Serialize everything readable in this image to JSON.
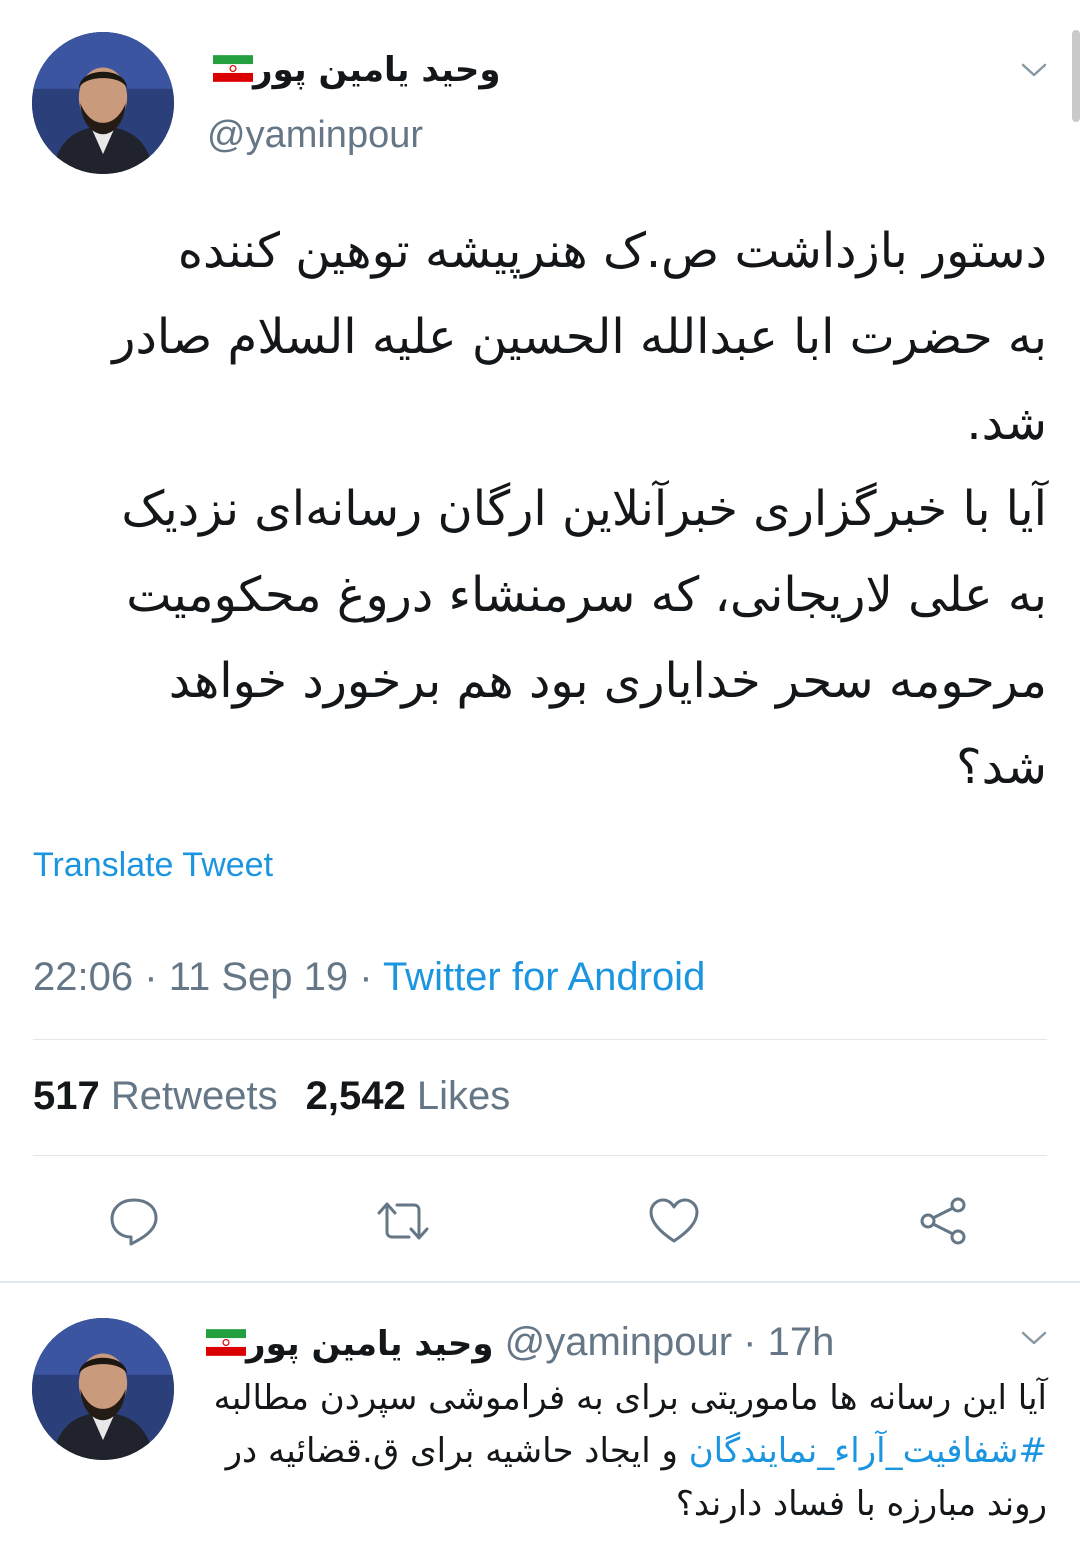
{
  "tweet": {
    "display_name": "وحید یامین پور",
    "handle": "@yaminpour",
    "text": "دستور بازداشت ص.ک هنرپیشه توهین کننده\nبه حضرت ابا عبدالله الحسین علیه السلام صادر\nشد.\nآیا با خبرگزاری خبرآنلاین ارگان رسانه‌ای نزدیک\nبه علی لاریجانی، که سرمنشاء دروغ محکومیت\nمرحومه سحر خدایاری بود هم برخورد خواهد\nشد؟",
    "translate_label": "Translate Tweet",
    "time": "22:06",
    "date": "11 Sep 19",
    "source": "Twitter for Android",
    "retweets_count": "517",
    "retweets_label": "Retweets",
    "likes_count": "2,542",
    "likes_label": "Likes"
  },
  "reply": {
    "display_name": "وحید یامین پور",
    "handle": "@yaminpour",
    "age": "17h",
    "text_part1": "آیا این رسانه ها ماموریتی برای به فراموشی سپردن مطالبه ",
    "hashtag": "#شفافیت_آراء_نمایندگان",
    "text_part2": " و ایجاد حاشیه برای ق.قضائیه در روند مبارزه با فساد دارند؟"
  },
  "icons": {
    "avatar": "profile-photo",
    "flag": "iran-flag-icon",
    "chevron": "chevron-down-icon",
    "reply": "reply-icon",
    "retweet": "retweet-icon",
    "like": "heart-icon",
    "share": "share-icon"
  },
  "colors": {
    "link": "#1b95e0",
    "muted": "#657786",
    "text": "#14171a",
    "divider": "#e1e8ed"
  }
}
